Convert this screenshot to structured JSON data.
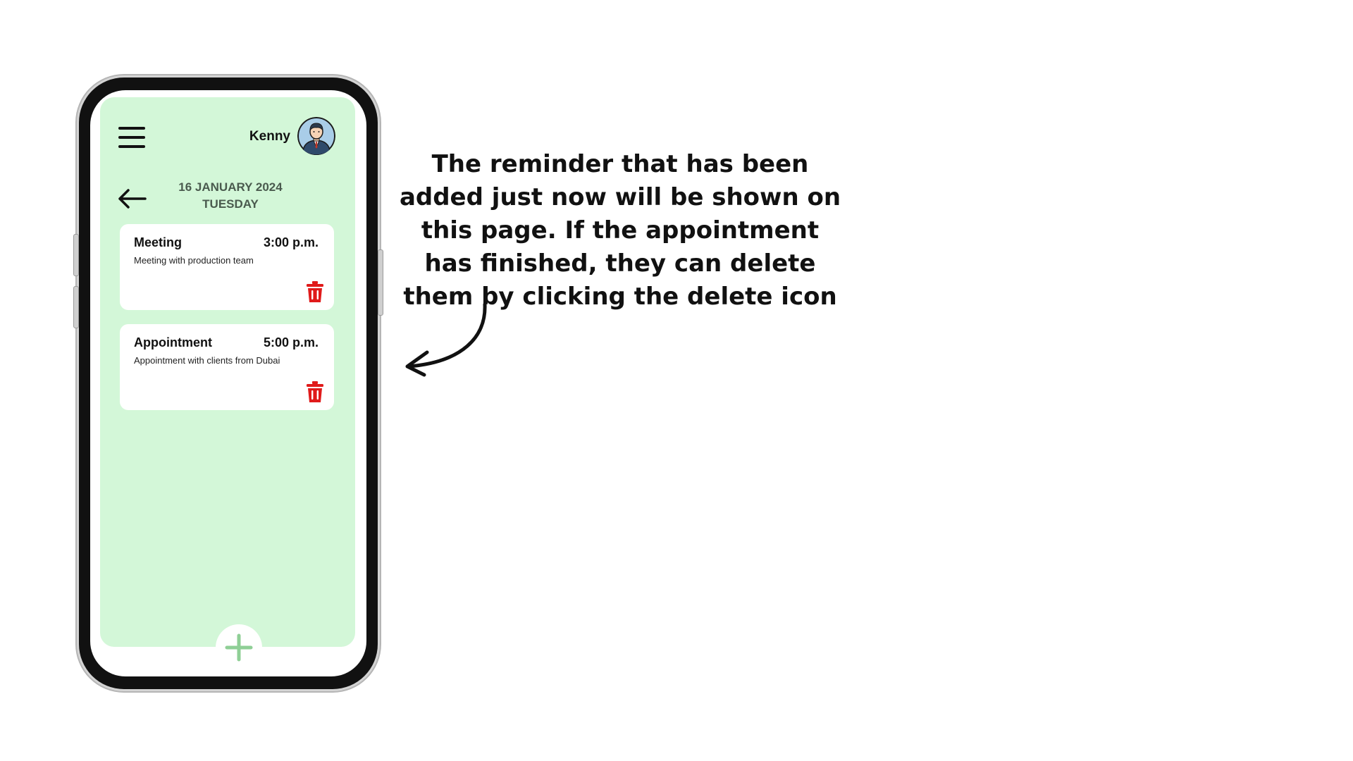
{
  "header": {
    "user_name": "Kenny"
  },
  "date": {
    "date_line": "16 JANUARY 2024",
    "day_line": "TUESDAY"
  },
  "reminders": [
    {
      "title": "Meeting",
      "time": "3:00 p.m.",
      "description": "Meeting with production team"
    },
    {
      "title": "Appointment",
      "time": "5:00 p.m.",
      "description": "Appointment with clients from Dubai"
    }
  ],
  "annotation": {
    "text": "The reminder that has been added just now will be shown on this page. If the appointment has finished, they can delete them by clicking the delete icon"
  },
  "icons": {
    "menu": "hamburger-menu-icon",
    "avatar": "user-avatar",
    "back": "arrow-left-icon",
    "delete": "trash-icon",
    "add": "plus-icon",
    "annotation_arrow": "curved-arrow-icon"
  },
  "colors": {
    "app_background": "#d3f7d8",
    "card_background": "#ffffff",
    "delete_red": "#e01b1b",
    "add_green": "#8fcf96",
    "date_text": "#4a5a4e"
  }
}
